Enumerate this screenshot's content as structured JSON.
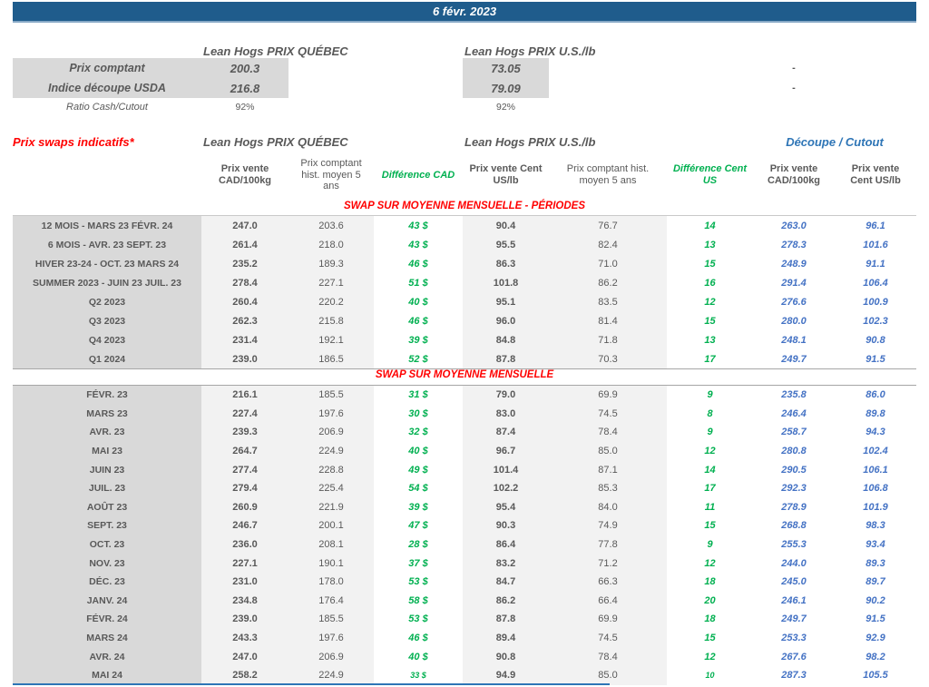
{
  "title_bar": {
    "date": "6 févr. 2023"
  },
  "colors": {
    "header_bar_bg": "#1F5C8C",
    "accent_blue": "#2E75B6",
    "value_blue": "#4472C4",
    "diff_green": "#00B050",
    "section_red": "#FF0000",
    "label_gray_bg": "#D9D9D9",
    "band_gray_bg": "#F2F2F2",
    "text_gray": "#595959"
  },
  "spot": {
    "qc_header": "Lean Hogs PRIX QUÉBEC",
    "us_header": "Lean Hogs PRIX U.S./lb",
    "rows": [
      {
        "label": "Prix comptant",
        "qc": "200.3",
        "us": "73.05",
        "dash": "-"
      },
      {
        "label": "Indice découpe USDA",
        "qc": "216.8",
        "us": "79.09",
        "dash": "-"
      },
      {
        "label": "Ratio Cash/Cutout",
        "qc": "92%",
        "us": "92%",
        "dash": ""
      }
    ]
  },
  "swaps": {
    "title": "Prix swaps indicatifs*",
    "qc_header": "Lean Hogs PRIX QUÉBEC",
    "us_header": "Lean Hogs PRIX U.S./lb",
    "cutout_header": "Découpe / Cutout",
    "col_headers": [
      "Prix vente CAD/100kg",
      "Prix comptant hist. moyen 5 ans",
      "Différence CAD",
      "Prix vente Cent US/lb",
      "Prix comptant hist. moyen 5 ans",
      "Différence Cent US",
      "Prix vente CAD/100kg",
      "Prix vente Cent US/lb"
    ],
    "sections": [
      {
        "header": "SWAP SUR MOYENNE MENSUELLE - PÉRIODES",
        "rows": [
          {
            "label": "12 MOIS - MARS 23 FÉVR. 24",
            "qc_sell": "247.0",
            "qc_hist": "203.6",
            "diff_cad": "43 $",
            "us_sell": "90.4",
            "us_hist": "76.7",
            "diff_us": "14",
            "cut_cad": "263.0",
            "cut_us": "96.1"
          },
          {
            "label": "6 MOIS - AVR. 23 SEPT. 23",
            "qc_sell": "261.4",
            "qc_hist": "218.0",
            "diff_cad": "43 $",
            "us_sell": "95.5",
            "us_hist": "82.4",
            "diff_us": "13",
            "cut_cad": "278.3",
            "cut_us": "101.6"
          },
          {
            "label": "HIVER 23-24 -  OCT. 23 MARS 24",
            "qc_sell": "235.2",
            "qc_hist": "189.3",
            "diff_cad": "46 $",
            "us_sell": "86.3",
            "us_hist": "71.0",
            "diff_us": "15",
            "cut_cad": "248.9",
            "cut_us": "91.1"
          },
          {
            "label": "SUMMER 2023 - JUIN 23 JUIL. 23",
            "qc_sell": "278.4",
            "qc_hist": "227.1",
            "diff_cad": "51 $",
            "us_sell": "101.8",
            "us_hist": "86.2",
            "diff_us": "16",
            "cut_cad": "291.4",
            "cut_us": "106.4"
          },
          {
            "label": "Q2 2023",
            "qc_sell": "260.4",
            "qc_hist": "220.2",
            "diff_cad": "40 $",
            "us_sell": "95.1",
            "us_hist": "83.5",
            "diff_us": "12",
            "cut_cad": "276.6",
            "cut_us": "100.9"
          },
          {
            "label": "Q3 2023",
            "qc_sell": "262.3",
            "qc_hist": "215.8",
            "diff_cad": "46 $",
            "us_sell": "96.0",
            "us_hist": "81.4",
            "diff_us": "15",
            "cut_cad": "280.0",
            "cut_us": "102.3"
          },
          {
            "label": "Q4 2023",
            "qc_sell": "231.4",
            "qc_hist": "192.1",
            "diff_cad": "39 $",
            "us_sell": "84.8",
            "us_hist": "71.8",
            "diff_us": "13",
            "cut_cad": "248.1",
            "cut_us": "90.8"
          },
          {
            "label": "Q1 2024",
            "qc_sell": "239.0",
            "qc_hist": "186.5",
            "diff_cad": "52 $",
            "us_sell": "87.8",
            "us_hist": "70.3",
            "diff_us": "17",
            "cut_cad": "249.7",
            "cut_us": "91.5"
          }
        ]
      },
      {
        "header": "SWAP SUR MOYENNE MENSUELLE",
        "rows": [
          {
            "label": "FÉVR. 23",
            "qc_sell": "216.1",
            "qc_hist": "185.5",
            "diff_cad": "31 $",
            "us_sell": "79.0",
            "us_hist": "69.9",
            "diff_us": "9",
            "cut_cad": "235.8",
            "cut_us": "86.0"
          },
          {
            "label": "MARS 23",
            "qc_sell": "227.4",
            "qc_hist": "197.6",
            "diff_cad": "30 $",
            "us_sell": "83.0",
            "us_hist": "74.5",
            "diff_us": "8",
            "cut_cad": "246.4",
            "cut_us": "89.8"
          },
          {
            "label": "AVR. 23",
            "qc_sell": "239.3",
            "qc_hist": "206.9",
            "diff_cad": "32 $",
            "us_sell": "87.4",
            "us_hist": "78.4",
            "diff_us": "9",
            "cut_cad": "258.7",
            "cut_us": "94.3"
          },
          {
            "label": "MAI 23",
            "qc_sell": "264.7",
            "qc_hist": "224.9",
            "diff_cad": "40 $",
            "us_sell": "96.7",
            "us_hist": "85.0",
            "diff_us": "12",
            "cut_cad": "280.8",
            "cut_us": "102.4"
          },
          {
            "label": "JUIN 23",
            "qc_sell": "277.4",
            "qc_hist": "228.8",
            "diff_cad": "49 $",
            "us_sell": "101.4",
            "us_hist": "87.1",
            "diff_us": "14",
            "cut_cad": "290.5",
            "cut_us": "106.1"
          },
          {
            "label": "JUIL. 23",
            "qc_sell": "279.4",
            "qc_hist": "225.4",
            "diff_cad": "54 $",
            "us_sell": "102.2",
            "us_hist": "85.3",
            "diff_us": "17",
            "cut_cad": "292.3",
            "cut_us": "106.8"
          },
          {
            "label": "AOÛT 23",
            "qc_sell": "260.9",
            "qc_hist": "221.9",
            "diff_cad": "39 $",
            "us_sell": "95.4",
            "us_hist": "84.0",
            "diff_us": "11",
            "cut_cad": "278.9",
            "cut_us": "101.9"
          },
          {
            "label": "SEPT. 23",
            "qc_sell": "246.7",
            "qc_hist": "200.1",
            "diff_cad": "47 $",
            "us_sell": "90.3",
            "us_hist": "74.9",
            "diff_us": "15",
            "cut_cad": "268.8",
            "cut_us": "98.3"
          },
          {
            "label": "OCT. 23",
            "qc_sell": "236.0",
            "qc_hist": "208.1",
            "diff_cad": "28 $",
            "us_sell": "86.4",
            "us_hist": "77.8",
            "diff_us": "9",
            "cut_cad": "255.3",
            "cut_us": "93.4"
          },
          {
            "label": "NOV. 23",
            "qc_sell": "227.1",
            "qc_hist": "190.1",
            "diff_cad": "37 $",
            "us_sell": "83.2",
            "us_hist": "71.2",
            "diff_us": "12",
            "cut_cad": "244.0",
            "cut_us": "89.3"
          },
          {
            "label": "DÉC. 23",
            "qc_sell": "231.0",
            "qc_hist": "178.0",
            "diff_cad": "53 $",
            "us_sell": "84.7",
            "us_hist": "66.3",
            "diff_us": "18",
            "cut_cad": "245.0",
            "cut_us": "89.7"
          },
          {
            "label": "JANV. 24",
            "qc_sell": "234.8",
            "qc_hist": "176.4",
            "diff_cad": "58 $",
            "us_sell": "86.2",
            "us_hist": "66.4",
            "diff_us": "20",
            "cut_cad": "246.1",
            "cut_us": "90.2"
          },
          {
            "label": "FÉVR. 24",
            "qc_sell": "239.0",
            "qc_hist": "185.5",
            "diff_cad": "53 $",
            "us_sell": "87.8",
            "us_hist": "69.9",
            "diff_us": "18",
            "cut_cad": "249.7",
            "cut_us": "91.5"
          },
          {
            "label": "MARS 24",
            "qc_sell": "243.3",
            "qc_hist": "197.6",
            "diff_cad": "46 $",
            "us_sell": "89.4",
            "us_hist": "74.5",
            "diff_us": "15",
            "cut_cad": "253.3",
            "cut_us": "92.9"
          },
          {
            "label": "AVR. 24",
            "qc_sell": "247.0",
            "qc_hist": "206.9",
            "diff_cad": "40 $",
            "us_sell": "90.8",
            "us_hist": "78.4",
            "diff_us": "12",
            "cut_cad": "267.6",
            "cut_us": "98.2"
          },
          {
            "label": "MAI 24",
            "qc_sell": "258.2",
            "qc_hist": "224.9",
            "diff_cad": "33 $",
            "us_sell": "94.9",
            "us_hist": "85.0",
            "diff_us": "10",
            "cut_cad": "287.3",
            "cut_us": "105.5",
            "diff_small": true
          }
        ]
      }
    ]
  }
}
